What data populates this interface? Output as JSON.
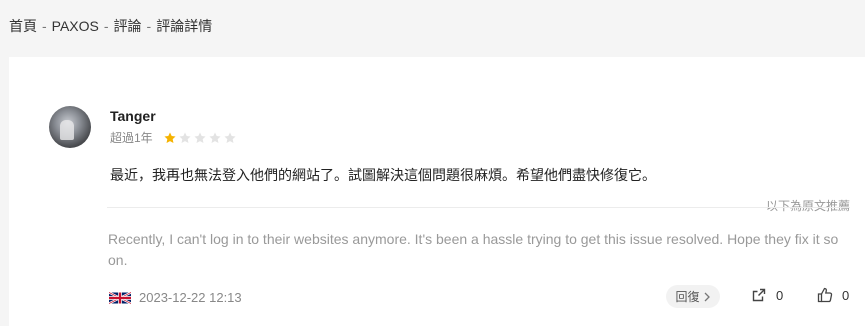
{
  "breadcrumb": {
    "items": [
      "首頁",
      "PAXOS",
      "評論",
      "評論詳情"
    ],
    "separator": "-"
  },
  "review": {
    "username": "Tanger",
    "time_ago": "超過1年",
    "rating": 1,
    "rating_max": 5,
    "translated_text": "最近，我再也無法登入他們的網站了。試圖解決這個問題很麻煩。希望他們盡快修復它。",
    "translate_note": "以下為原文推薦",
    "original_text": "Recently, I can't log in to their websites anymore. It's been a hassle trying to get this issue resolved. Hope they fix it so on.",
    "country_flag_icon": "uk-flag-icon",
    "date": "2023-12-22 12:13"
  },
  "actions": {
    "reply_label": "回復",
    "share_count": "0",
    "like_count": "0"
  },
  "colors": {
    "star_filled": "#f5b301",
    "star_empty": "#e3e3e3",
    "muted_text": "#999999"
  }
}
